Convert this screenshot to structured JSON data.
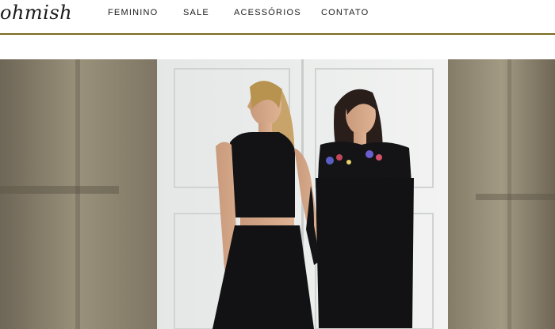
{
  "brand": {
    "logo_text": "ohmish"
  },
  "nav": {
    "items": [
      {
        "label": "FEMININO"
      },
      {
        "label": "SALE"
      },
      {
        "label": "ACESSÓRIOS"
      },
      {
        "label": "CONTATO"
      }
    ]
  },
  "colors": {
    "accent_rule": "#7a6a1f",
    "stone": "#8f8672",
    "door": "#e9ebea",
    "garment": "#121214"
  },
  "hero": {
    "image_description_icon": "fashion-photo"
  }
}
